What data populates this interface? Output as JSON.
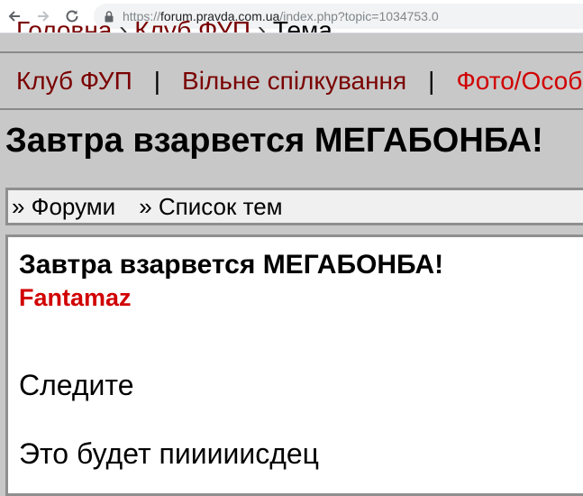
{
  "browser": {
    "url_scheme": "https://",
    "url_host": "forum.pravda.com.ua",
    "url_path": "/index.php?topic=1034753.0"
  },
  "breadcrumb": {
    "home": "Головна",
    "sep": "›",
    "club": "Клуб ФУП",
    "current": "Тема"
  },
  "club_nav": {
    "items": [
      "Клуб ФУП",
      "Вільне спілкування",
      "Фото/Особи"
    ],
    "separator": "|"
  },
  "page_title": "Завтра взарвется МЕГАБОНБА!",
  "forum_nav": {
    "forums": "» Форуми",
    "topics": "» Список тем"
  },
  "post": {
    "title": "Завтра взарвется МЕГАБОНБА!",
    "author": "Fantamaz",
    "lines": [
      "Следите",
      "Это будет пииииисдец"
    ]
  },
  "colors": {
    "link": "#7a0000",
    "active_link": "#d10000",
    "page_bg": "#c8c8c8"
  }
}
